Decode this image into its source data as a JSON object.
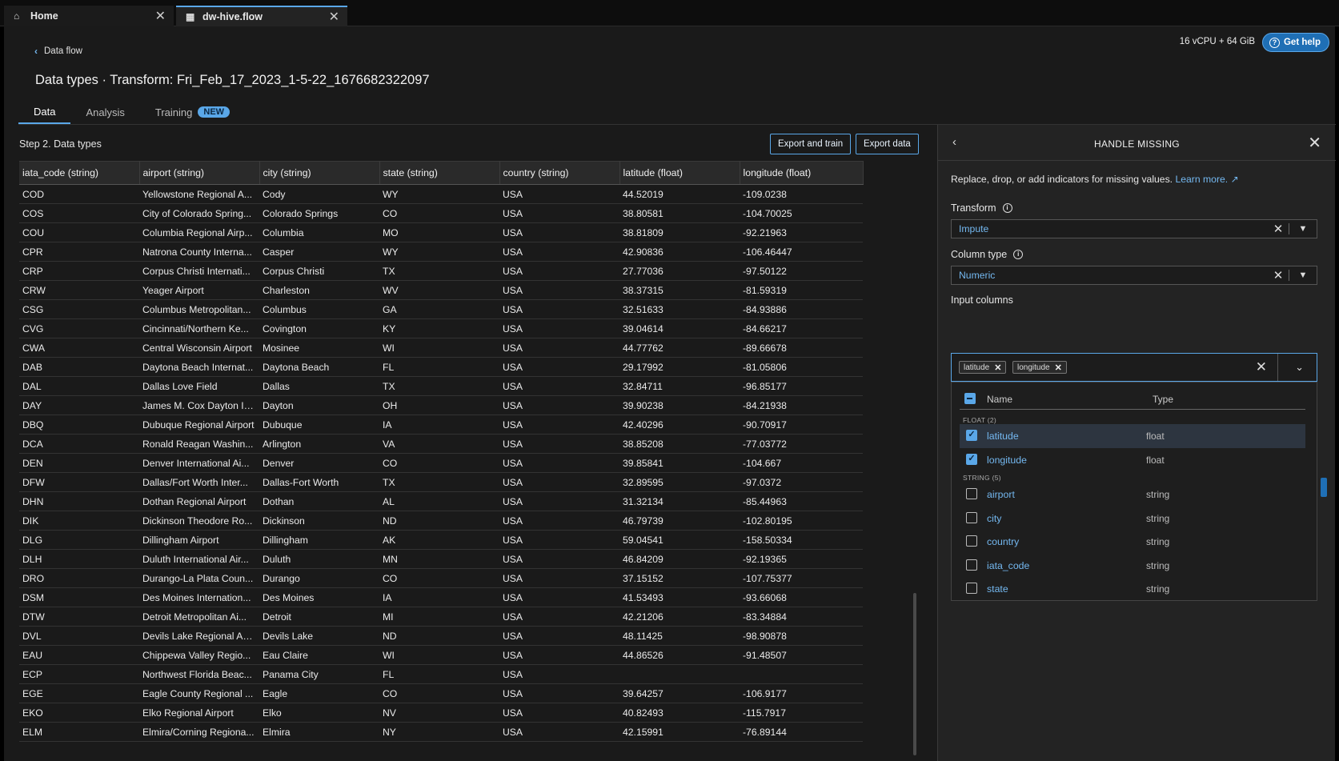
{
  "tabs": [
    {
      "label": "Home",
      "icon": "home-icon"
    },
    {
      "label": "dw-hive.flow",
      "icon": "flow-icon"
    }
  ],
  "header": {
    "breadcrumb": "Data flow",
    "title": "Data types · Transform: Fri_Feb_17_2023_1-5-22_1676682322097",
    "resources": "16 vCPU + 64 GiB",
    "help_label": "Get help"
  },
  "nav": {
    "tabs": [
      "Data",
      "Analysis",
      "Training"
    ],
    "new_badge": "NEW"
  },
  "data_panel": {
    "step_label": "Step 2. Data types",
    "export_train_label": "Export and train",
    "export_data_label": "Export data",
    "columns": [
      "iata_code (string)",
      "airport (string)",
      "city (string)",
      "state (string)",
      "country (string)",
      "latitude (float)",
      "longitude (float)"
    ],
    "rows": [
      [
        "COD",
        "Yellowstone Regional A...",
        "Cody",
        "WY",
        "USA",
        "44.52019",
        "-109.0238"
      ],
      [
        "COS",
        "City of Colorado Spring...",
        "Colorado Springs",
        "CO",
        "USA",
        "38.80581",
        "-104.70025"
      ],
      [
        "COU",
        "Columbia Regional Airp...",
        "Columbia",
        "MO",
        "USA",
        "38.81809",
        "-92.21963"
      ],
      [
        "CPR",
        "Natrona County Interna...",
        "Casper",
        "WY",
        "USA",
        "42.90836",
        "-106.46447"
      ],
      [
        "CRP",
        "Corpus Christi Internati...",
        "Corpus Christi",
        "TX",
        "USA",
        "27.77036",
        "-97.50122"
      ],
      [
        "CRW",
        "Yeager Airport",
        "Charleston",
        "WV",
        "USA",
        "38.37315",
        "-81.59319"
      ],
      [
        "CSG",
        "Columbus Metropolitan...",
        "Columbus",
        "GA",
        "USA",
        "32.51633",
        "-84.93886"
      ],
      [
        "CVG",
        "Cincinnati/Northern Ke...",
        "Covington",
        "KY",
        "USA",
        "39.04614",
        "-84.66217"
      ],
      [
        "CWA",
        "Central Wisconsin Airport",
        "Mosinee",
        "WI",
        "USA",
        "44.77762",
        "-89.66678"
      ],
      [
        "DAB",
        "Daytona Beach Internat...",
        "Daytona Beach",
        "FL",
        "USA",
        "29.17992",
        "-81.05806"
      ],
      [
        "DAL",
        "Dallas Love Field",
        "Dallas",
        "TX",
        "USA",
        "32.84711",
        "-96.85177"
      ],
      [
        "DAY",
        "James M. Cox Dayton In...",
        "Dayton",
        "OH",
        "USA",
        "39.90238",
        "-84.21938"
      ],
      [
        "DBQ",
        "Dubuque Regional Airport",
        "Dubuque",
        "IA",
        "USA",
        "42.40296",
        "-90.70917"
      ],
      [
        "DCA",
        "Ronald Reagan Washin...",
        "Arlington",
        "VA",
        "USA",
        "38.85208",
        "-77.03772"
      ],
      [
        "DEN",
        "Denver International Ai...",
        "Denver",
        "CO",
        "USA",
        "39.85841",
        "-104.667"
      ],
      [
        "DFW",
        "Dallas/Fort Worth Inter...",
        "Dallas-Fort Worth",
        "TX",
        "USA",
        "32.89595",
        "-97.0372"
      ],
      [
        "DHN",
        "Dothan Regional Airport",
        "Dothan",
        "AL",
        "USA",
        "31.32134",
        "-85.44963"
      ],
      [
        "DIK",
        "Dickinson Theodore Ro...",
        "Dickinson",
        "ND",
        "USA",
        "46.79739",
        "-102.80195"
      ],
      [
        "DLG",
        "Dillingham Airport",
        "Dillingham",
        "AK",
        "USA",
        "59.04541",
        "-158.50334"
      ],
      [
        "DLH",
        "Duluth International Air...",
        "Duluth",
        "MN",
        "USA",
        "46.84209",
        "-92.19365"
      ],
      [
        "DRO",
        "Durango-La Plata Coun...",
        "Durango",
        "CO",
        "USA",
        "37.15152",
        "-107.75377"
      ],
      [
        "DSM",
        "Des Moines Internation...",
        "Des Moines",
        "IA",
        "USA",
        "41.53493",
        "-93.66068"
      ],
      [
        "DTW",
        "Detroit Metropolitan Ai...",
        "Detroit",
        "MI",
        "USA",
        "42.21206",
        "-83.34884"
      ],
      [
        "DVL",
        "Devils Lake Regional Air...",
        "Devils Lake",
        "ND",
        "USA",
        "48.11425",
        "-98.90878"
      ],
      [
        "EAU",
        "Chippewa Valley Regio...",
        "Eau Claire",
        "WI",
        "USA",
        "44.86526",
        "-91.48507"
      ],
      [
        "ECP",
        "Northwest Florida Beac...",
        "Panama City",
        "FL",
        "USA",
        "",
        ""
      ],
      [
        "EGE",
        "Eagle County Regional ...",
        "Eagle",
        "CO",
        "USA",
        "39.64257",
        "-106.9177"
      ],
      [
        "EKO",
        "Elko Regional Airport",
        "Elko",
        "NV",
        "USA",
        "40.82493",
        "-115.7917"
      ],
      [
        "ELM",
        "Elmira/Corning Regiona...",
        "Elmira",
        "NY",
        "USA",
        "42.15991",
        "-76.89144"
      ]
    ]
  },
  "side_panel": {
    "title": "HANDLE MISSING",
    "description": "Replace, drop, or add indicators for missing values.",
    "learn_more": "Learn more.",
    "transform_label": "Transform",
    "transform_value": "Impute",
    "column_type_label": "Column type",
    "column_type_value": "Numeric",
    "input_columns_label": "Input columns",
    "chips": [
      "latitude",
      "longitude"
    ],
    "dropdown": {
      "name_header": "Name",
      "type_header": "Type",
      "groups": [
        {
          "label": "FLOAT (2)",
          "options": [
            {
              "name": "latitude",
              "type": "float",
              "checked": true
            },
            {
              "name": "longitude",
              "type": "float",
              "checked": true
            }
          ]
        },
        {
          "label": "STRING (5)",
          "options": [
            {
              "name": "airport",
              "type": "string",
              "checked": false
            },
            {
              "name": "city",
              "type": "string",
              "checked": false
            },
            {
              "name": "country",
              "type": "string",
              "checked": false
            },
            {
              "name": "iata_code",
              "type": "string",
              "checked": false
            },
            {
              "name": "state",
              "type": "string",
              "checked": false
            }
          ]
        }
      ]
    }
  },
  "colors": {
    "accent": "#5aa7e8",
    "background": "#1a1a1a",
    "panel": "#232323"
  }
}
